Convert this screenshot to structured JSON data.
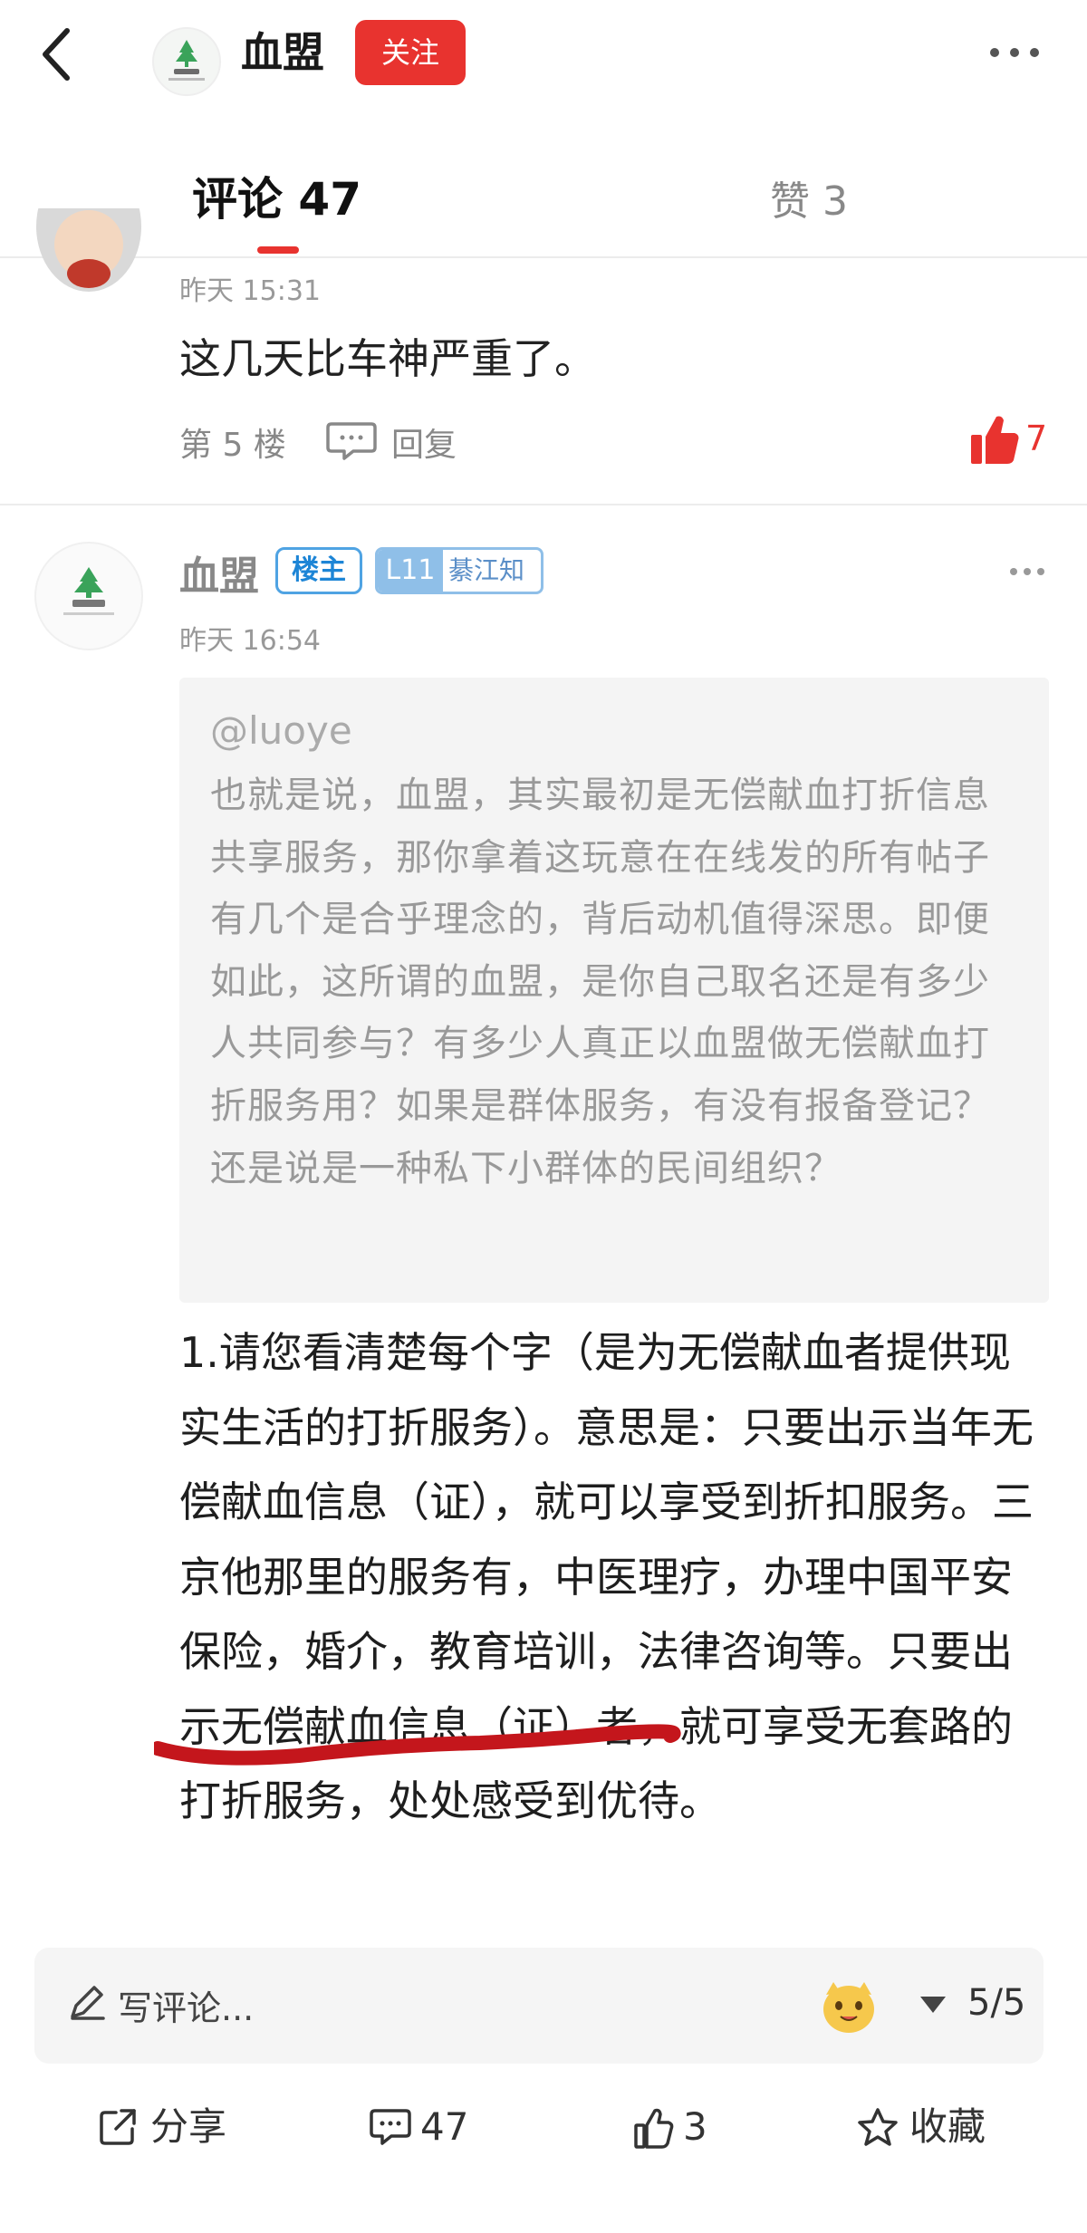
{
  "header": {
    "title": "血盟",
    "follow_label": "关注",
    "icons": [
      "back-icon",
      "more-icon"
    ]
  },
  "tabs": {
    "comments_label": "评论 47",
    "likes_label": "赞 3"
  },
  "comments": [
    {
      "time": "昨天 15:31",
      "text": "这几天比车神严重了。",
      "floor": "第 5 楼",
      "reply_label": "回复",
      "likes": "7"
    },
    {
      "author": "血盟",
      "owner_badge": "楼主",
      "level": "L11",
      "level_title": "綦江知府",
      "time": "昨天 16:54",
      "quote_mention": "@luoye",
      "quote_text": "也就是说，血盟，其实最初是无偿献血打折信息共享服务，那你拿着这玩意在在线发的所有帖子有几个是合乎理念的，背后动机值得深思。即便如此，这所谓的血盟，是你自己取名还是有多少人共同参与？有多少人真正以血盟做无偿献血打折服务用？如果是群体服务，有没有报备登记？还是说是一种私下小群体的民间组织？",
      "body_text": "1.请您看清楚每个字（是为无偿献血者提供现实生活的打折服务）。意思是：只要出示当年无偿献血信息（证），就可以享受到折扣服务。三京他那里的服务有，中医理疗，办理中国平安保险，婚介，教育培训，法律咨询等。只要出示无偿献血信息（证）者，就可享受无套路的打折服务，处处感受到优待。"
    }
  ],
  "composer": {
    "placeholder": "写评论...",
    "page_counter": "5/5"
  },
  "actions": {
    "share": "分享",
    "comments": "47",
    "likes": "3",
    "favorite": "收藏"
  },
  "colors": {
    "accent_red": "#e8332f",
    "owner_badge_blue": "#1d85d6",
    "level_badge_blue": "#8fbfe8"
  }
}
